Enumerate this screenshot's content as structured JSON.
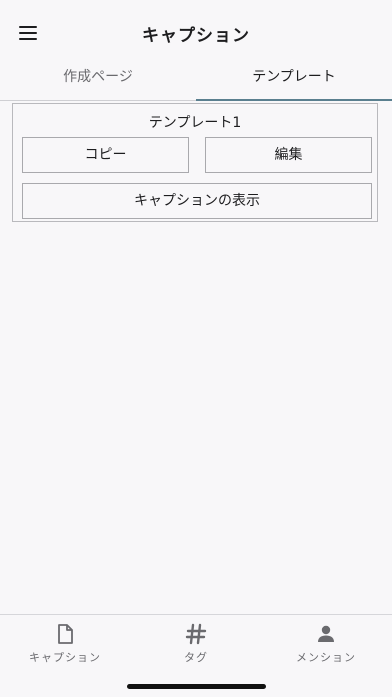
{
  "header": {
    "title": "キャプション"
  },
  "tabs": [
    {
      "label": "作成ページ",
      "selected": false
    },
    {
      "label": "テンプレート",
      "selected": true
    }
  ],
  "template_card": {
    "title": "テンプレート1",
    "copy_label": "コピー",
    "edit_label": "編集",
    "show_caption_label": "キャプションの表示"
  },
  "bottom_nav": {
    "items": [
      {
        "label": "キャプション",
        "icon": "document-icon"
      },
      {
        "label": "タグ",
        "icon": "hashtag-icon"
      },
      {
        "label": "メンション",
        "icon": "person-icon"
      }
    ]
  },
  "colors": {
    "background": "#f8f7f9",
    "text": "#1d1d1f",
    "muted_text": "#6a6a6e",
    "tab_indicator": "#5a7f8f",
    "icon": "#6a6a6e"
  }
}
